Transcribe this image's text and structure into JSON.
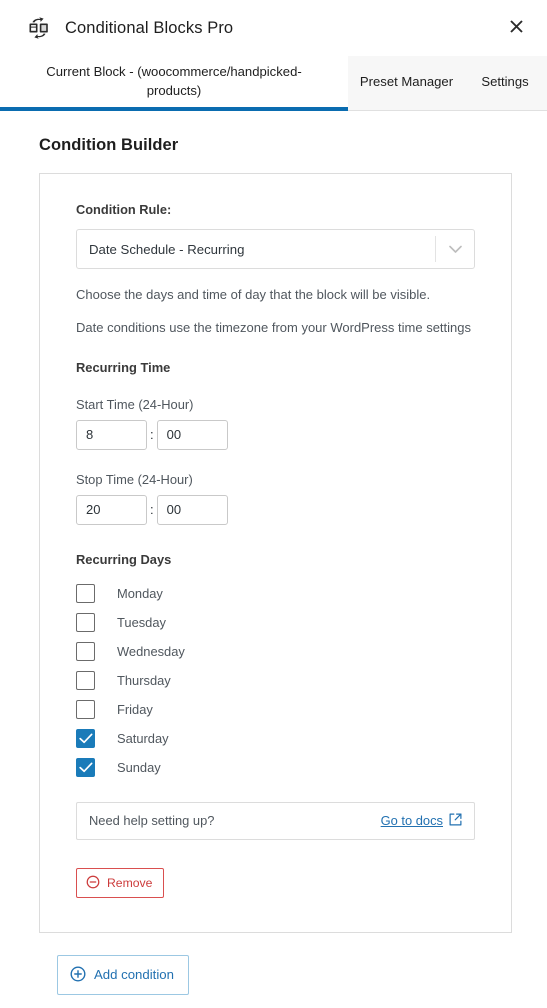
{
  "header": {
    "title": "Conditional Blocks Pro",
    "logo_icon": "swap-blocks-icon",
    "close_icon": "close-icon"
  },
  "tabs": [
    {
      "label": "Current Block - (woocommerce/handpicked-products)",
      "active": true
    },
    {
      "label": "Preset Manager",
      "active": false
    },
    {
      "label": "Settings",
      "active": false
    }
  ],
  "main": {
    "page_title": "Condition Builder",
    "condition": {
      "rule_label": "Condition Rule:",
      "rule_value": "Date Schedule - Recurring",
      "rule_chevron_icon": "chevron-down-icon",
      "description_1": "Choose the days and time of day that the block will be visible.",
      "description_2": "Date conditions use the timezone from your WordPress time settings",
      "recurring_time_heading": "Recurring Time",
      "start_time_label": "Start Time (24-Hour)",
      "start_hours": "8",
      "start_minutes": "00",
      "stop_time_label": "Stop Time (24-Hour)",
      "stop_hours": "20",
      "stop_minutes": "00",
      "time_separator": ":",
      "recurring_days_heading": "Recurring Days",
      "days": [
        {
          "label": "Monday",
          "checked": false
        },
        {
          "label": "Tuesday",
          "checked": false
        },
        {
          "label": "Wednesday",
          "checked": false
        },
        {
          "label": "Thursday",
          "checked": false
        },
        {
          "label": "Friday",
          "checked": false
        },
        {
          "label": "Saturday",
          "checked": true
        },
        {
          "label": "Sunday",
          "checked": true
        }
      ],
      "docs_prompt": "Need help setting up?",
      "docs_link_label": "Go to docs",
      "docs_link_icon": "external-link-icon",
      "remove_label": "Remove",
      "remove_icon": "minus-circle-icon"
    },
    "add_condition_label": "Add condition",
    "add_condition_icon": "plus-circle-icon"
  },
  "colors": {
    "accent": "#0a6cb0",
    "checkbox_checked": "#1a7bb9",
    "link": "#2271b1",
    "danger": "#cc3b3b",
    "tabbar_bg": "#f7f7f7"
  }
}
